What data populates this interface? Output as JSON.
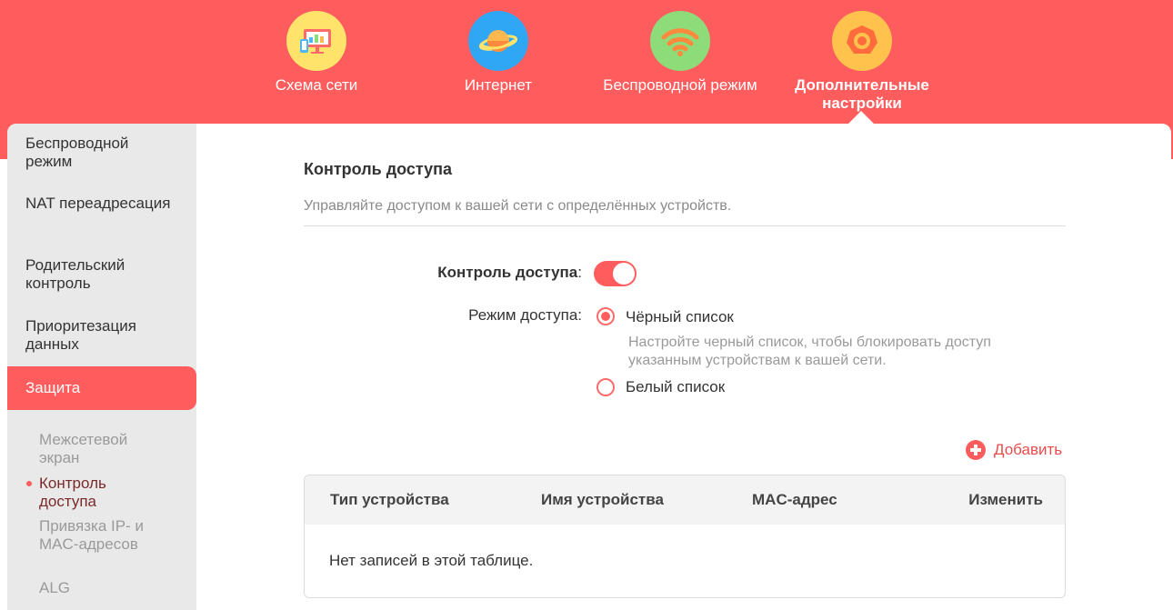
{
  "colors": {
    "brand": "#ff5d5d",
    "sidebar_bg": "#e9e9e9",
    "active_sub": "#7a2a2a"
  },
  "topnav": [
    {
      "label": "Схема сети",
      "icon": "network-map-icon",
      "color": "#ffe36b"
    },
    {
      "label": "Интернет",
      "icon": "planet-icon",
      "color": "#30a7f5"
    },
    {
      "label": "Беспроводной режим",
      "icon": "wifi-icon",
      "color": "#8ddb79"
    },
    {
      "label": "Дополнительные настройки",
      "icon": "gear-icon",
      "color": "#ffc34d",
      "active": true
    }
  ],
  "sidebar": {
    "items": [
      {
        "label": "Беспроводной режим"
      },
      {
        "label": "NAT переадресация"
      },
      {
        "label": "Родительский контроль"
      },
      {
        "label": "Приоритезация данных"
      },
      {
        "label": "Защита",
        "active": true
      }
    ],
    "subitems": [
      {
        "label": "Межсетевой экран"
      },
      {
        "label": "Контроль доступа",
        "current": true
      },
      {
        "label": "Привязка IP- и MAC-адресов"
      },
      {
        "label": "ALG"
      }
    ]
  },
  "content": {
    "title": "Контроль доступа",
    "description": "Управляйте доступом к вашей сети с определённых устройств.",
    "access_control_label": "Контроль доступа",
    "access_control_enabled": true,
    "access_mode_label": "Режим доступа:",
    "modes": [
      {
        "label": "Чёрный список",
        "selected": true
      },
      {
        "label": "Белый список",
        "selected": false
      }
    ],
    "blacklist_hint": "Настройте черный список, чтобы блокировать доступ указанным устройствам к вашей сети.",
    "add_label": "Добавить",
    "table": {
      "columns": [
        "Тип устройства",
        "Имя устройства",
        "MAC-адрес",
        "Изменить"
      ],
      "empty_text": "Нет записей в этой таблице."
    }
  }
}
